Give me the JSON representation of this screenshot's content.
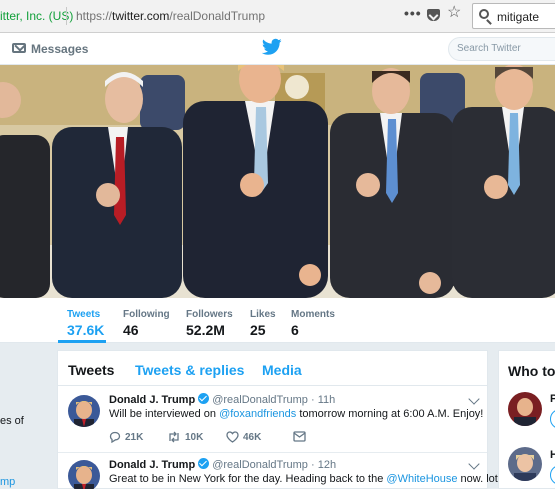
{
  "browser": {
    "identity": "itter, Inc. (US)",
    "url_prefix": "https://",
    "url_host": "twitter.com",
    "url_path": "/realDonaldTrump",
    "menu_glyph": "•••",
    "star_glyph": "☆",
    "search_query": "mitigate"
  },
  "nav": {
    "messages_label": "Messages",
    "search_placeholder": "Search Twitter",
    "brand_color": "#1da1f2"
  },
  "stats": [
    {
      "label": "Tweets",
      "value": "37.6K"
    },
    {
      "label": "Following",
      "value": "46"
    },
    {
      "label": "Followers",
      "value": "52.2M"
    },
    {
      "label": "Likes",
      "value": "25"
    },
    {
      "label": "Moments",
      "value": "6"
    }
  ],
  "left_column": {
    "snippet_1": "es of",
    "snippet_2": "mp"
  },
  "timeline": {
    "tabs": [
      "Tweets",
      "Tweets & replies",
      "Media"
    ],
    "tweets": [
      {
        "name": "Donald J. Trump",
        "handle": "@realDonaldTrump",
        "sep": "·",
        "time": "11h",
        "text_before": "Will be interviewed on ",
        "mention": "@foxandfriends",
        "text_after": " tomorrow morning at 6:00 A.M. Enjoy!",
        "replies": "21K",
        "retweets": "10K",
        "likes": "46K"
      },
      {
        "name": "Donald J. Trump",
        "handle": "@realDonaldTrump",
        "sep": "·",
        "time": "12h",
        "text_before": "Great to be in New York for the day. Heading back to the ",
        "mention": "@WhiteHouse",
        "text_after": " now. lots"
      }
    ]
  },
  "right_column": {
    "title": "Who to",
    "suggestions": [
      {
        "initial": "P"
      },
      {
        "initial": "H"
      }
    ]
  }
}
